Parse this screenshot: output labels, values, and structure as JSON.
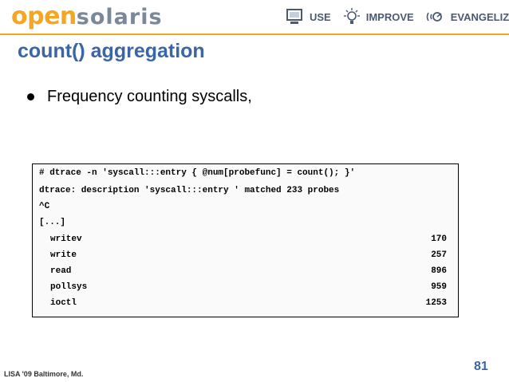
{
  "header": {
    "logo_open": "open",
    "logo_solaris": "solaris",
    "nav": [
      {
        "label": "USE",
        "icon": "computer-icon"
      },
      {
        "label": "IMPROVE",
        "icon": "lightbulb-icon"
      },
      {
        "label": "EVANGELIZE",
        "icon": "broadcast-icon"
      }
    ],
    "accent_color": "#f5a623"
  },
  "slide": {
    "title": "count() aggregation",
    "bullet": "Frequency counting syscalls,",
    "code_lines": [
      "# dtrace -n 'syscall:::entry { @num[probefunc] = count(); }'",
      "dtrace: description 'syscall:::entry ' matched 233 probes",
      "^C",
      "[...]"
    ],
    "rows": [
      {
        "name": "writev",
        "count": "170"
      },
      {
        "name": "write",
        "count": "257"
      },
      {
        "name": "read",
        "count": "896"
      },
      {
        "name": "pollsys",
        "count": "959"
      },
      {
        "name": "ioctl",
        "count": "1253"
      }
    ]
  },
  "footer": {
    "left_text": "LISA '09 Baltimore, Md.",
    "page_number": "81"
  }
}
